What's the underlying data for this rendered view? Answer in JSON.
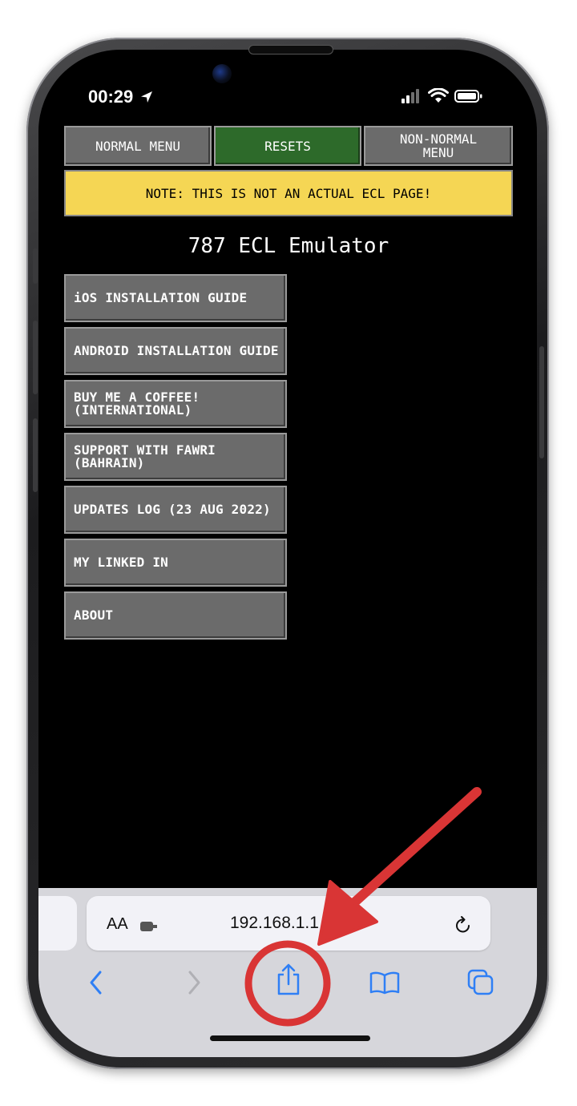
{
  "status_bar": {
    "time": "00:29"
  },
  "ecl": {
    "tabs": [
      {
        "label": "NORMAL MENU",
        "active": false
      },
      {
        "label": "RESETS",
        "active": true
      },
      {
        "label": "NON-NORMAL MENU",
        "active": false
      }
    ],
    "note": "NOTE: THIS IS NOT AN ACTUAL ECL PAGE!",
    "title": "787 ECL Emulator",
    "menu_items": [
      "iOS INSTALLATION GUIDE",
      "ANDROID INSTALLATION GUIDE",
      "BUY ME A COFFEE! (INTERNATIONAL)",
      "SUPPORT WITH FAWRI (BAHRAIN)",
      "UPDATES LOG (23 AUG 2022)",
      "MY LINKED IN",
      "ABOUT"
    ]
  },
  "safari": {
    "text_size_label": "AA",
    "url": "192.168.1.1",
    "icons": [
      "back-icon",
      "forward-icon",
      "share-icon",
      "bookmarks-icon",
      "tabs-icon",
      "reload-icon",
      "extension-icon"
    ]
  },
  "colors": {
    "tab_gray": "#6b6b6b",
    "tab_active_green": "#2d6a2a",
    "note_yellow": "#f5d654",
    "safari_blue": "#2f7ff5",
    "annotation_red": "#d93535"
  }
}
